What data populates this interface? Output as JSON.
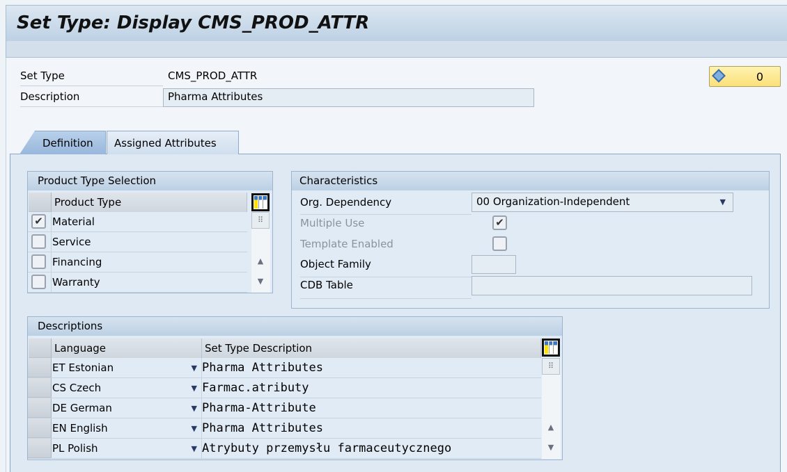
{
  "window": {
    "title": "Set Type: Display CMS_PROD_ATTR"
  },
  "header": {
    "set_type_label": "Set Type",
    "set_type_value": "CMS_PROD_ATTR",
    "description_label": "Description",
    "description_value": "Pharma Attributes",
    "status_badge": {
      "icon": "diamond-icon",
      "value": "0"
    }
  },
  "tabs": [
    {
      "label": "Definition",
      "active": true
    },
    {
      "label": "Assigned Attributes",
      "active": false
    }
  ],
  "product_type_selection": {
    "title": "Product Type Selection",
    "column": "Product Type",
    "rows": [
      {
        "label": "Material",
        "checked": true
      },
      {
        "label": "Service",
        "checked": false
      },
      {
        "label": "Financing",
        "checked": false
      },
      {
        "label": "Warranty",
        "checked": false
      }
    ]
  },
  "characteristics": {
    "title": "Characteristics",
    "org_dependency_label": "Org. Dependency",
    "org_dependency_value": "00 Organization-Independent",
    "multiple_use_label": "Multiple Use",
    "multiple_use_checked": true,
    "template_enabled_label": "Template Enabled",
    "template_enabled_checked": false,
    "object_family_label": "Object Family",
    "object_family_value": "",
    "cdb_table_label": "CDB Table",
    "cdb_table_value": ""
  },
  "descriptions": {
    "title": "Descriptions",
    "columns": [
      "Language",
      "Set Type Description"
    ],
    "rows": [
      {
        "language": "ET Estonian",
        "description": "Pharma Attributes"
      },
      {
        "language": "CS Czech",
        "description": "Farmac.atributy"
      },
      {
        "language": "DE German",
        "description": "Pharma-Attribute"
      },
      {
        "language": "EN English",
        "description": "Pharma Attributes"
      },
      {
        "language": "PL Polish",
        "description": "Atrybuty przemysłu farmaceutycznego"
      }
    ]
  },
  "colors": {
    "title_bar": "#c8d8e8",
    "panel": "#dfe9f4",
    "badge": "#fde98c"
  }
}
